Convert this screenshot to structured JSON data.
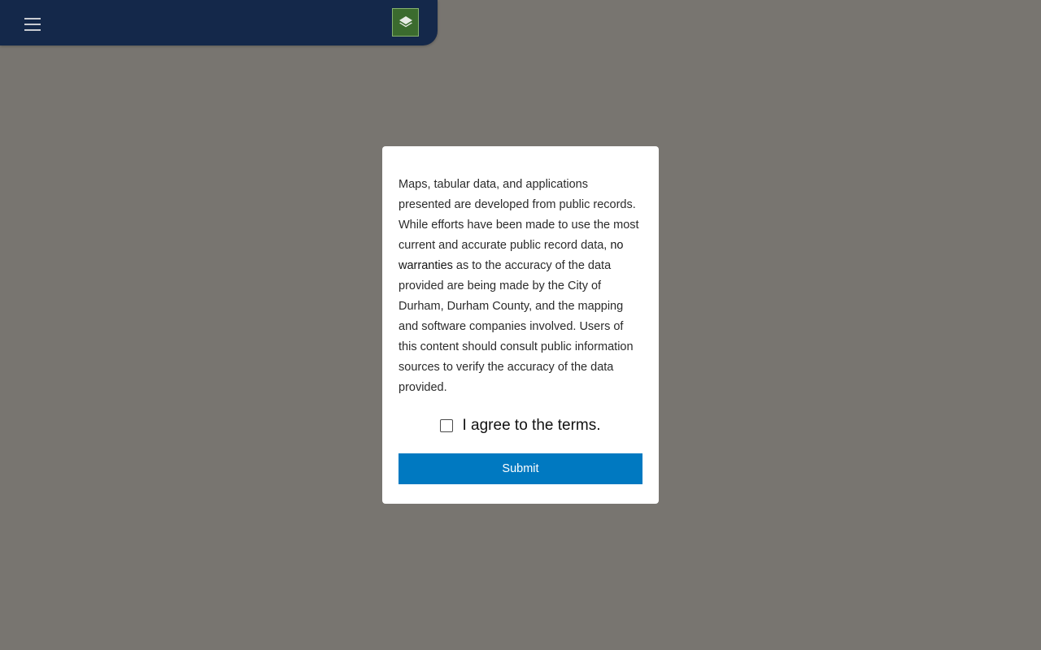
{
  "header": {
    "menu_icon": "hamburger-menu-icon",
    "layers_icon": "layers-icon",
    "layers_button_color": "#3b6b2e",
    "background_color": "#14284a"
  },
  "dialog": {
    "text_before": "Maps, tabular data, and applications presented are developed from public records. While efforts have been made to use the most current and accurate public record data, ",
    "text_emphasis": "no warranties",
    "text_after": " as to the accuracy of the data provided are being made by the City of Durham, Durham County, and the mapping and software companies involved. Users of this content should consult public information sources to verify the accuracy of the data provided.",
    "agree_label": "I agree to the terms.",
    "agree_checked": false,
    "submit_label": "Submit",
    "submit_color": "#0079c1"
  }
}
